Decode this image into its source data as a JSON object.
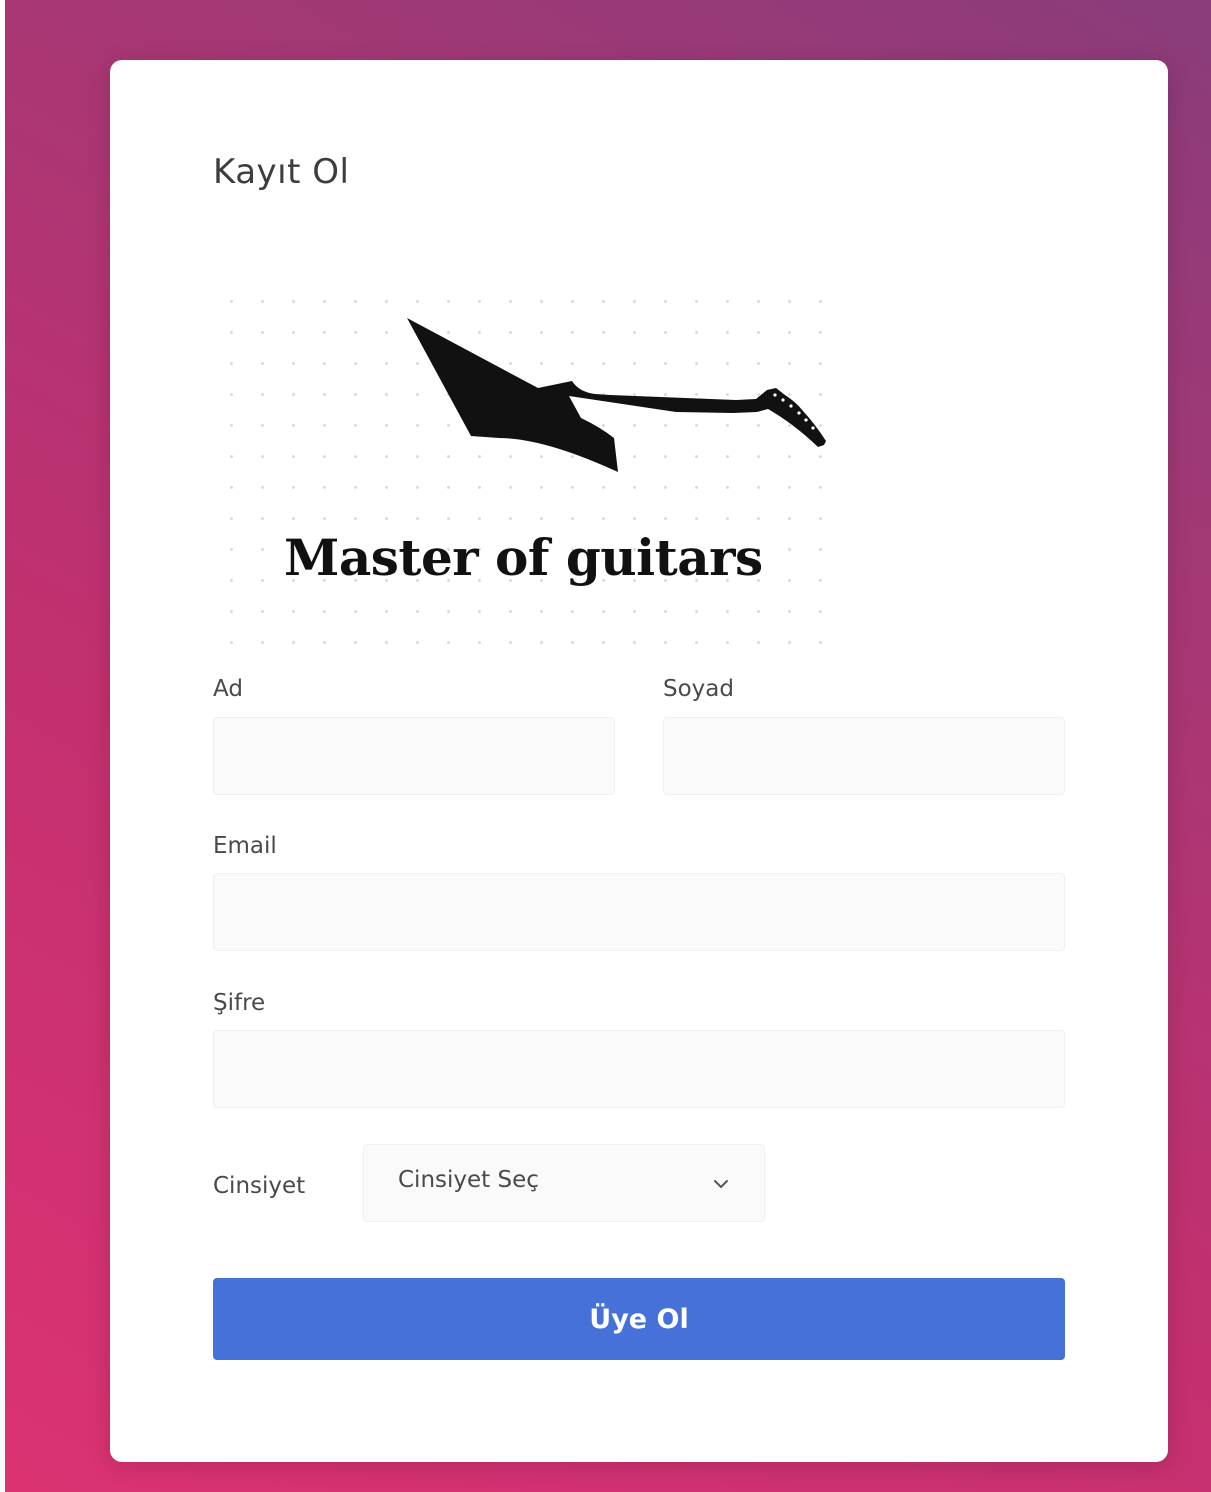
{
  "page": {
    "title": "Kayıt Ol"
  },
  "logo": {
    "text": "Master of guitars",
    "icon": "guitar-icon"
  },
  "form": {
    "first_name": {
      "label": "Ad",
      "value": "",
      "placeholder": ""
    },
    "last_name": {
      "label": "Soyad",
      "value": "",
      "placeholder": ""
    },
    "email": {
      "label": "Email",
      "value": "",
      "placeholder": ""
    },
    "password": {
      "label": "Şifre",
      "value": "",
      "placeholder": ""
    },
    "gender": {
      "label": "Cinsiyet",
      "selected": "Cinsiyet Seç",
      "icon": "chevron-down-icon"
    },
    "submit_label": "Üye Ol"
  },
  "colors": {
    "gradient_start": "#dc3272",
    "gradient_end": "#8a3c7a",
    "button": "#4571d9",
    "input_bg": "#fafafa"
  }
}
